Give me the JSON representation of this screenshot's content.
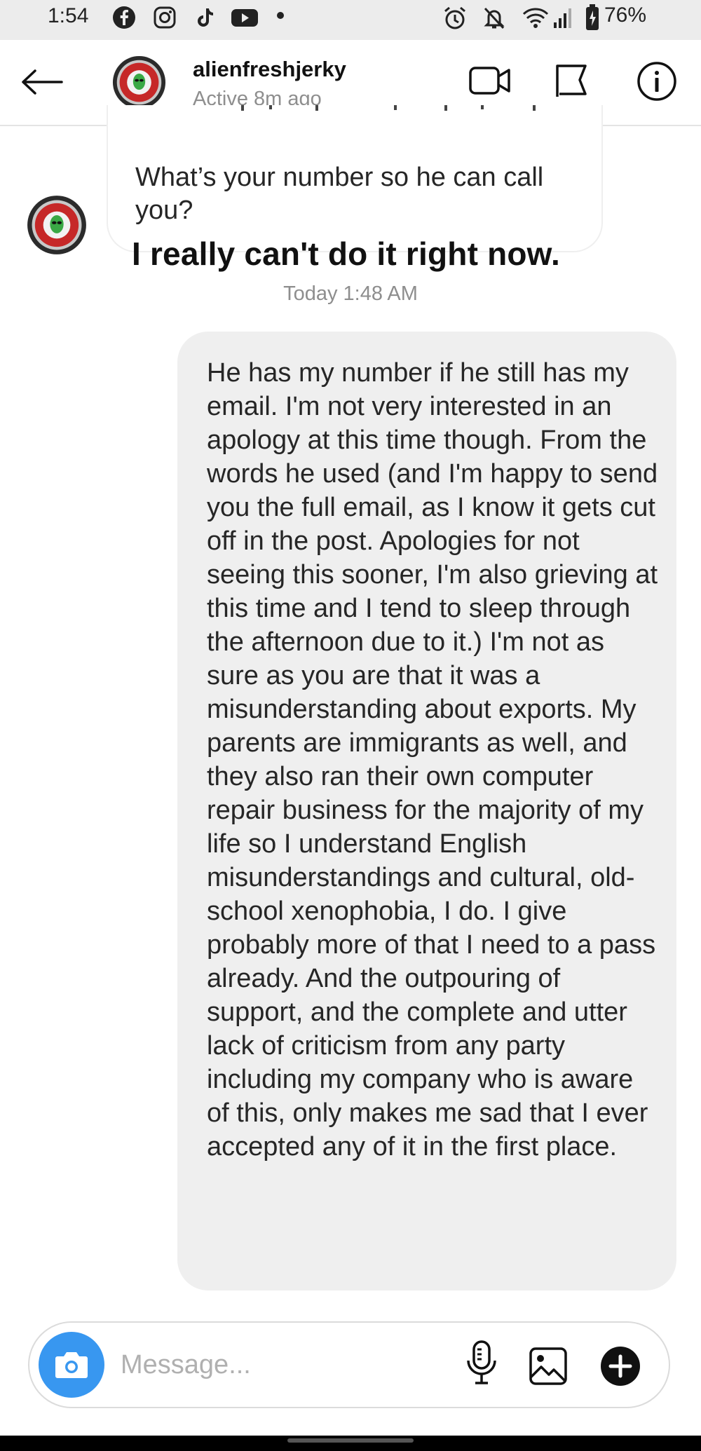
{
  "status_bar": {
    "time": "1:54",
    "battery": "76%",
    "left_icons": [
      "facebook-icon",
      "instagram-icon",
      "tiktok-icon",
      "youtube-icon",
      "dot-icon"
    ],
    "right_icons": [
      "alarm-icon",
      "mute-icon",
      "wifi-icon",
      "signal-icon",
      "battery-icon"
    ]
  },
  "header": {
    "username": "alienfreshjerky",
    "status": "Active 8m ago",
    "actions": [
      "video-call-icon",
      "flag-icon",
      "info-icon"
    ]
  },
  "thread": {
    "received_message": "What’s your number so he can call you?",
    "overlay_caption": "I really can't do it right now.",
    "timestamp": "Today 1:48 AM",
    "sent_message": "He has my number if he still has my email. I'm not very interested in an apology at this time though. From the words he used (and I'm happy to send you the full email, as I know it gets cut off in the post. Apologies for not seeing this sooner, I'm also grieving at this time and I tend to sleep through the afternoon due to it.) I'm not as sure as you are that it was a misunderstanding about exports. My parents are immigrants as well, and they also ran their own computer repair business for the majority of my life so I understand English misunderstandings and cultural, old-school xenophobia, I do. I give probably more of that I need to a pass already. And the outpouring of support, and the complete and utter lack of criticism from any party including my company who is aware of this, only makes me sad that I ever accepted any of it in the first place."
  },
  "composer": {
    "placeholder": "Message...",
    "icons": [
      "camera-icon",
      "microphone-icon",
      "gallery-icon",
      "add-icon"
    ]
  },
  "colors": {
    "accent_blue": "#3897f0",
    "bubble_gray": "#efefef",
    "secondary_text": "#8e8e8e"
  }
}
